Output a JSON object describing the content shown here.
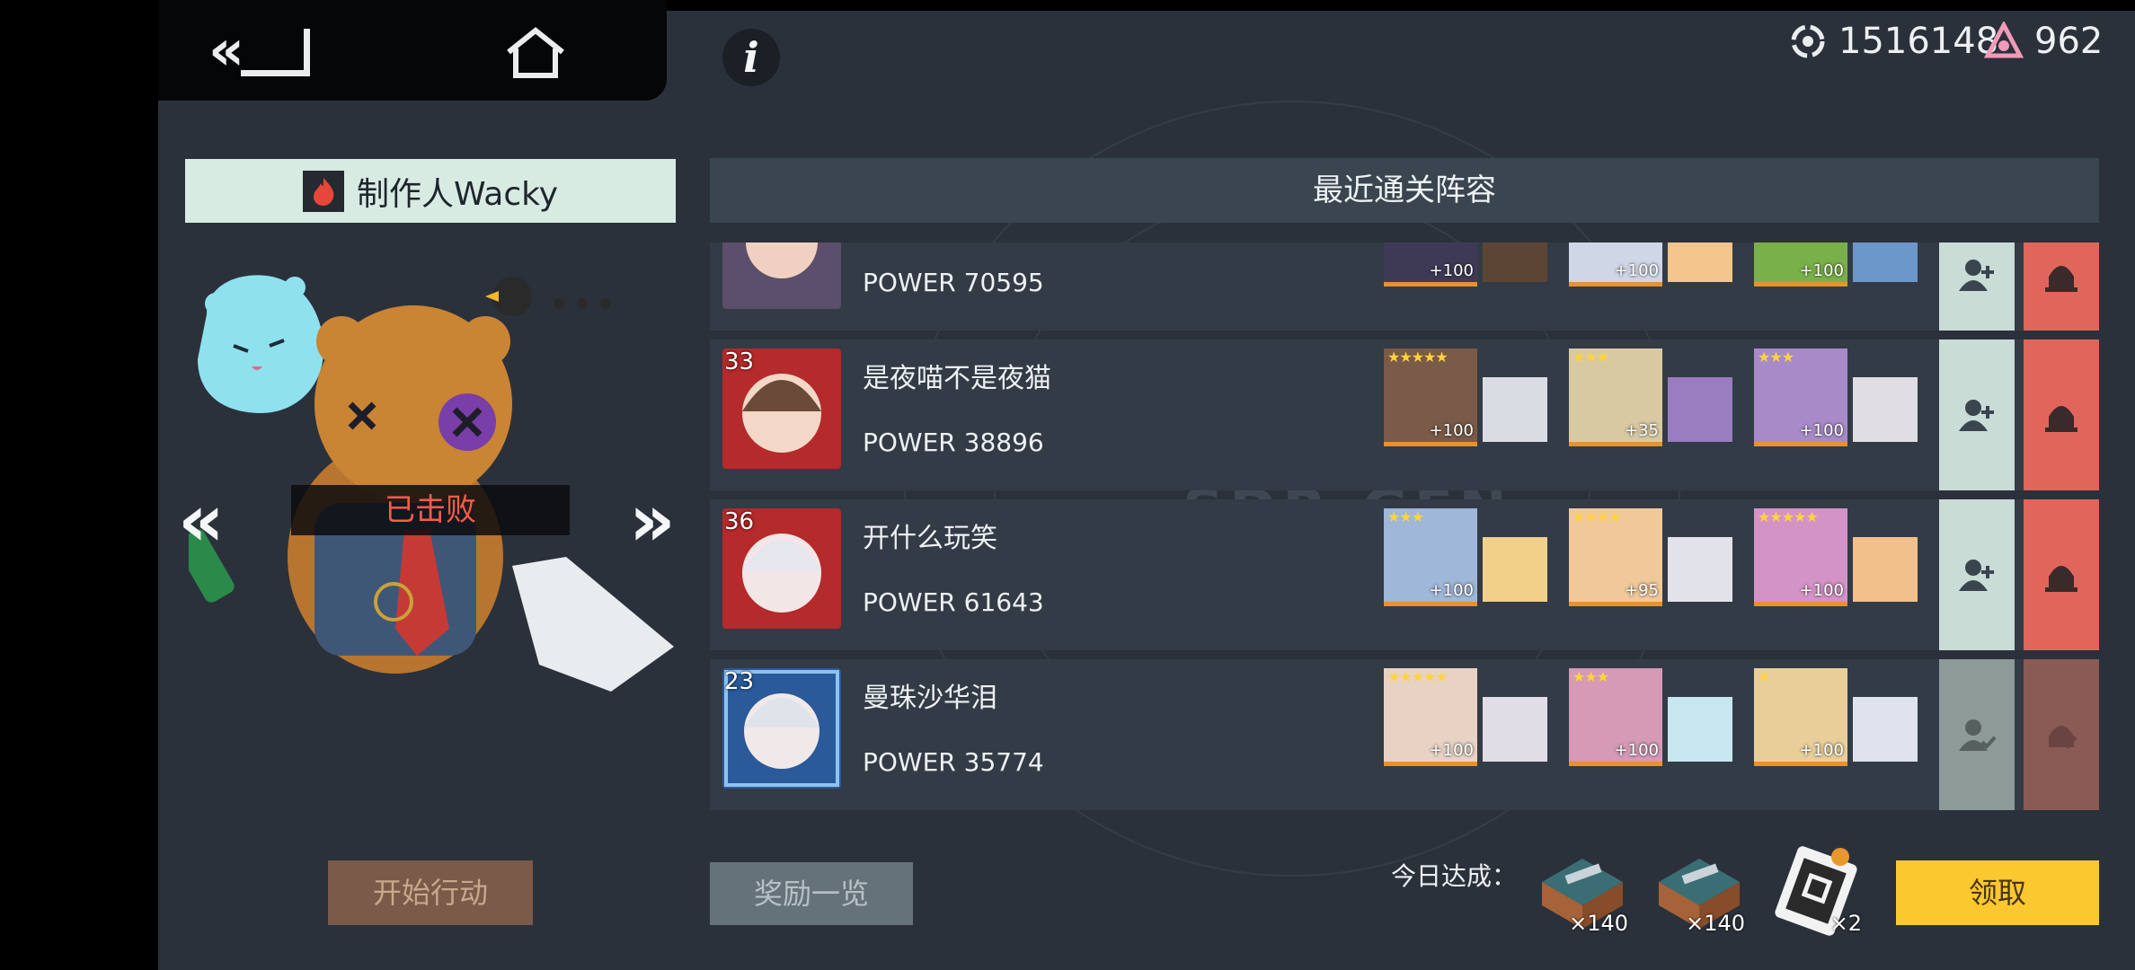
{
  "currency": {
    "coins": "1516148",
    "gems": "962"
  },
  "boss": {
    "name": "制作人Wacky",
    "status": "已击败"
  },
  "panel": {
    "title": "最近通关阵容"
  },
  "rows": [
    {
      "player": "",
      "level": "",
      "power": "POWER 70595",
      "heroes": [
        {
          "stars": "",
          "plus": "+100"
        },
        {
          "stars": "",
          "plus": "+100"
        },
        {
          "stars": "",
          "plus": "+100"
        }
      ]
    },
    {
      "player": "是夜喵不是夜猫",
      "level": "33",
      "power": "POWER 38896",
      "heroes": [
        {
          "stars": "★★★★★",
          "plus": "+100"
        },
        {
          "stars": "★★★",
          "plus": "+35"
        },
        {
          "stars": "★★★",
          "plus": "+100"
        }
      ]
    },
    {
      "player": "开什么玩笑",
      "level": "36",
      "power": "POWER 61643",
      "heroes": [
        {
          "stars": "★★★",
          "plus": "+100"
        },
        {
          "stars": "★★★★",
          "plus": "+95"
        },
        {
          "stars": "★★★★★",
          "plus": "+100"
        }
      ]
    },
    {
      "player": "曼珠沙华泪",
      "level": "23",
      "power": "POWER 35774",
      "heroes": [
        {
          "stars": "★★★★★",
          "plus": "+100"
        },
        {
          "stars": "★★★",
          "plus": "+100"
        },
        {
          "stars": "★",
          "plus": "+100"
        }
      ]
    }
  ],
  "buttons": {
    "start": "开始行动",
    "rewards": "奖励一览",
    "claim": "领取"
  },
  "today": {
    "label": "今日达成：",
    "items": [
      {
        "count": "×140"
      },
      {
        "count": "×140"
      },
      {
        "count": "×2"
      }
    ]
  },
  "colors": {
    "accent_yellow": "#fbc82f",
    "remove_red": "#e0665b",
    "add_mint": "#c9dcd5"
  }
}
